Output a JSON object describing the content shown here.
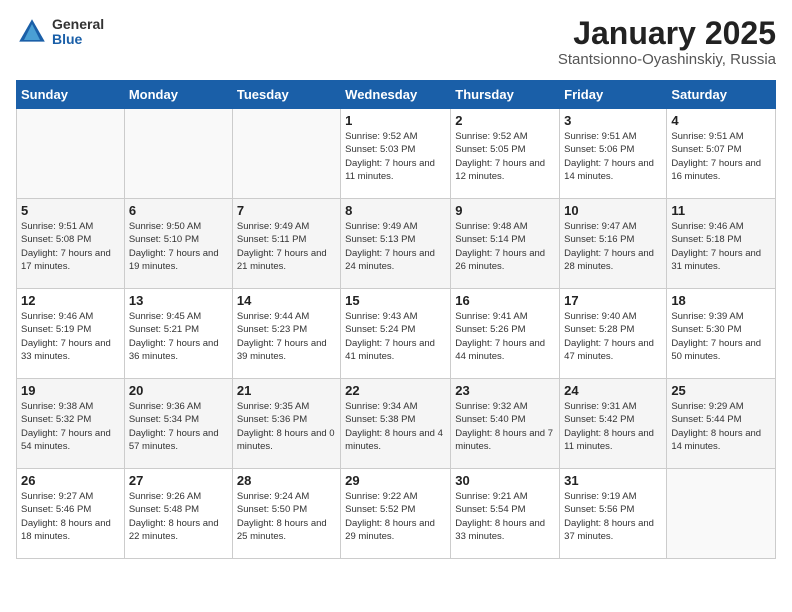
{
  "header": {
    "logo_general": "General",
    "logo_blue": "Blue",
    "title": "January 2025",
    "subtitle": "Stantsionno-Oyashinskiy, Russia"
  },
  "weekdays": [
    "Sunday",
    "Monday",
    "Tuesday",
    "Wednesday",
    "Thursday",
    "Friday",
    "Saturday"
  ],
  "weeks": [
    [
      {
        "day": "",
        "detail": ""
      },
      {
        "day": "",
        "detail": ""
      },
      {
        "day": "",
        "detail": ""
      },
      {
        "day": "1",
        "detail": "Sunrise: 9:52 AM\nSunset: 5:03 PM\nDaylight: 7 hours\nand 11 minutes."
      },
      {
        "day": "2",
        "detail": "Sunrise: 9:52 AM\nSunset: 5:05 PM\nDaylight: 7 hours\nand 12 minutes."
      },
      {
        "day": "3",
        "detail": "Sunrise: 9:51 AM\nSunset: 5:06 PM\nDaylight: 7 hours\nand 14 minutes."
      },
      {
        "day": "4",
        "detail": "Sunrise: 9:51 AM\nSunset: 5:07 PM\nDaylight: 7 hours\nand 16 minutes."
      }
    ],
    [
      {
        "day": "5",
        "detail": "Sunrise: 9:51 AM\nSunset: 5:08 PM\nDaylight: 7 hours\nand 17 minutes."
      },
      {
        "day": "6",
        "detail": "Sunrise: 9:50 AM\nSunset: 5:10 PM\nDaylight: 7 hours\nand 19 minutes."
      },
      {
        "day": "7",
        "detail": "Sunrise: 9:49 AM\nSunset: 5:11 PM\nDaylight: 7 hours\nand 21 minutes."
      },
      {
        "day": "8",
        "detail": "Sunrise: 9:49 AM\nSunset: 5:13 PM\nDaylight: 7 hours\nand 24 minutes."
      },
      {
        "day": "9",
        "detail": "Sunrise: 9:48 AM\nSunset: 5:14 PM\nDaylight: 7 hours\nand 26 minutes."
      },
      {
        "day": "10",
        "detail": "Sunrise: 9:47 AM\nSunset: 5:16 PM\nDaylight: 7 hours\nand 28 minutes."
      },
      {
        "day": "11",
        "detail": "Sunrise: 9:46 AM\nSunset: 5:18 PM\nDaylight: 7 hours\nand 31 minutes."
      }
    ],
    [
      {
        "day": "12",
        "detail": "Sunrise: 9:46 AM\nSunset: 5:19 PM\nDaylight: 7 hours\nand 33 minutes."
      },
      {
        "day": "13",
        "detail": "Sunrise: 9:45 AM\nSunset: 5:21 PM\nDaylight: 7 hours\nand 36 minutes."
      },
      {
        "day": "14",
        "detail": "Sunrise: 9:44 AM\nSunset: 5:23 PM\nDaylight: 7 hours\nand 39 minutes."
      },
      {
        "day": "15",
        "detail": "Sunrise: 9:43 AM\nSunset: 5:24 PM\nDaylight: 7 hours\nand 41 minutes."
      },
      {
        "day": "16",
        "detail": "Sunrise: 9:41 AM\nSunset: 5:26 PM\nDaylight: 7 hours\nand 44 minutes."
      },
      {
        "day": "17",
        "detail": "Sunrise: 9:40 AM\nSunset: 5:28 PM\nDaylight: 7 hours\nand 47 minutes."
      },
      {
        "day": "18",
        "detail": "Sunrise: 9:39 AM\nSunset: 5:30 PM\nDaylight: 7 hours\nand 50 minutes."
      }
    ],
    [
      {
        "day": "19",
        "detail": "Sunrise: 9:38 AM\nSunset: 5:32 PM\nDaylight: 7 hours\nand 54 minutes."
      },
      {
        "day": "20",
        "detail": "Sunrise: 9:36 AM\nSunset: 5:34 PM\nDaylight: 7 hours\nand 57 minutes."
      },
      {
        "day": "21",
        "detail": "Sunrise: 9:35 AM\nSunset: 5:36 PM\nDaylight: 8 hours\nand 0 minutes."
      },
      {
        "day": "22",
        "detail": "Sunrise: 9:34 AM\nSunset: 5:38 PM\nDaylight: 8 hours\nand 4 minutes."
      },
      {
        "day": "23",
        "detail": "Sunrise: 9:32 AM\nSunset: 5:40 PM\nDaylight: 8 hours\nand 7 minutes."
      },
      {
        "day": "24",
        "detail": "Sunrise: 9:31 AM\nSunset: 5:42 PM\nDaylight: 8 hours\nand 11 minutes."
      },
      {
        "day": "25",
        "detail": "Sunrise: 9:29 AM\nSunset: 5:44 PM\nDaylight: 8 hours\nand 14 minutes."
      }
    ],
    [
      {
        "day": "26",
        "detail": "Sunrise: 9:27 AM\nSunset: 5:46 PM\nDaylight: 8 hours\nand 18 minutes."
      },
      {
        "day": "27",
        "detail": "Sunrise: 9:26 AM\nSunset: 5:48 PM\nDaylight: 8 hours\nand 22 minutes."
      },
      {
        "day": "28",
        "detail": "Sunrise: 9:24 AM\nSunset: 5:50 PM\nDaylight: 8 hours\nand 25 minutes."
      },
      {
        "day": "29",
        "detail": "Sunrise: 9:22 AM\nSunset: 5:52 PM\nDaylight: 8 hours\nand 29 minutes."
      },
      {
        "day": "30",
        "detail": "Sunrise: 9:21 AM\nSunset: 5:54 PM\nDaylight: 8 hours\nand 33 minutes."
      },
      {
        "day": "31",
        "detail": "Sunrise: 9:19 AM\nSunset: 5:56 PM\nDaylight: 8 hours\nand 37 minutes."
      },
      {
        "day": "",
        "detail": ""
      }
    ]
  ]
}
